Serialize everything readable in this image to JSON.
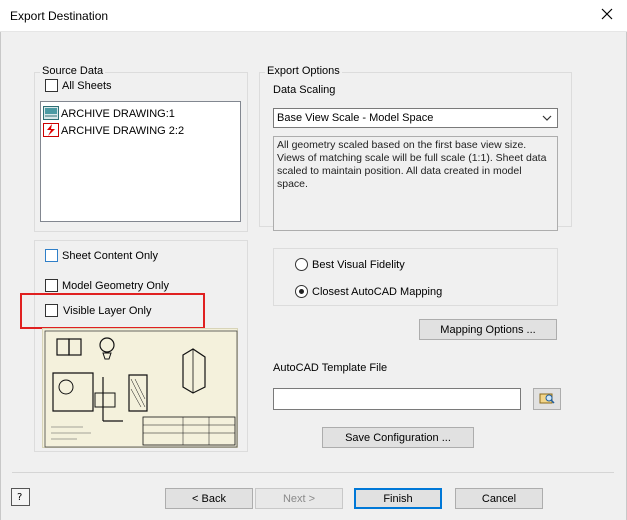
{
  "window": {
    "title": "Export Destination",
    "close_icon": "close-icon"
  },
  "source_data": {
    "group_label": "Source Data",
    "all_sheets_label": "All Sheets",
    "items": [
      {
        "label": "ARCHIVE DRAWING:1",
        "icon": "drawing-sheet-icon"
      },
      {
        "label": "ARCHIVE DRAWING 2:2",
        "icon": "drawing-sheet-error-icon"
      }
    ]
  },
  "content_options": {
    "sheet_content_only_label": "Sheet Content Only",
    "model_geometry_only_label": "Model Geometry Only",
    "visible_layer_only_label": "Visible Layer Only"
  },
  "export_options": {
    "group_label": "Export Options",
    "data_scaling_label": "Data Scaling",
    "data_scaling_value": "Base View Scale - Model Space",
    "description": "All geometry scaled based on the first base view size. Views of matching scale will be full scale (1:1). Sheet data scaled to maintain position. All data created in model space.",
    "radio_best_visual_fidelity": "Best Visual Fidelity",
    "radio_closest_autocad_mapping": "Closest AutoCAD Mapping",
    "selected_radio": "Closest AutoCAD Mapping",
    "mapping_options_label": "Mapping Options ...",
    "template_file_label": "AutoCAD Template File",
    "template_file_value": "",
    "save_configuration_label": "Save Configuration ..."
  },
  "footer": {
    "help_icon": "help-icon",
    "back_label": "< Back",
    "next_label": "Next >",
    "finish_label": "Finish",
    "cancel_label": "Cancel"
  },
  "colors": {
    "accent": "#0078d7",
    "highlight": "#e02020"
  }
}
